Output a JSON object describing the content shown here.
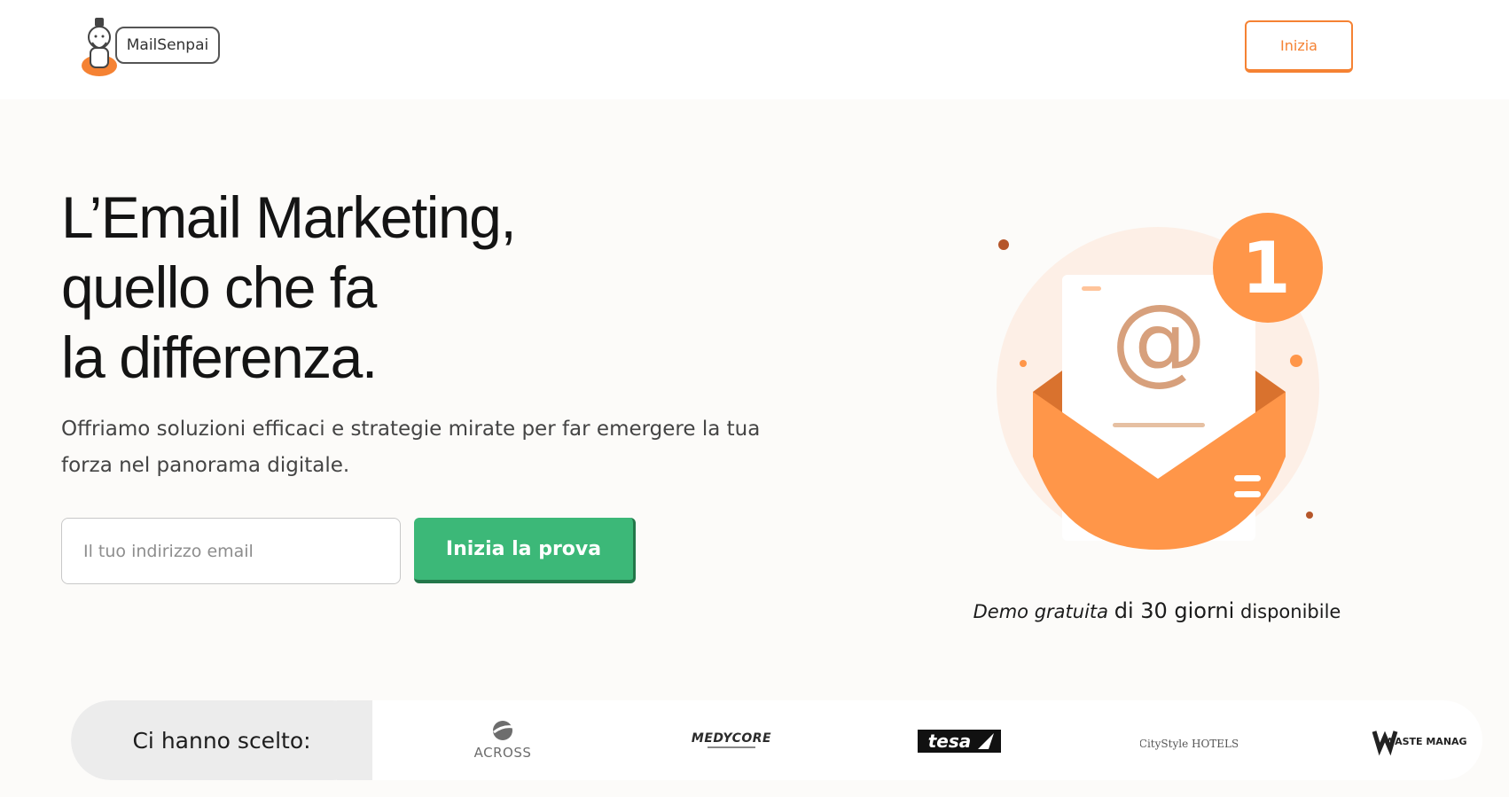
{
  "header": {
    "logo_text": "MailSenpai",
    "cta_label": "Inizia"
  },
  "hero": {
    "title_lines": [
      "L’Email Marketing,",
      "quello che fa",
      "la differenza."
    ],
    "subtitle": "Offriamo soluzioni efficaci e strategie mirate per far emergere la tua forza nel panorama digitale.",
    "email_placeholder": "Il tuo indirizzo email",
    "trial_button": "Inizia la prova"
  },
  "illustration": {
    "badge_number": "1",
    "at_symbol": "@"
  },
  "demo": {
    "italic_part": "Demo gratuita",
    "middle_part": "di 30 giorni",
    "end_part": "disponibile"
  },
  "clients": {
    "label": "Ci hanno scelto:",
    "logos": [
      {
        "name": "ACROSS"
      },
      {
        "name": "MEDYCORE"
      },
      {
        "name": "tesa"
      },
      {
        "name": "CityStyle HOTELS"
      },
      {
        "name": "WASTE MANAGER"
      }
    ]
  },
  "colors": {
    "brand_orange": "#f58233",
    "green_cta": "#3cb878",
    "illustration_orange": "#ff9649",
    "circle_bg": "#fdefe6"
  }
}
